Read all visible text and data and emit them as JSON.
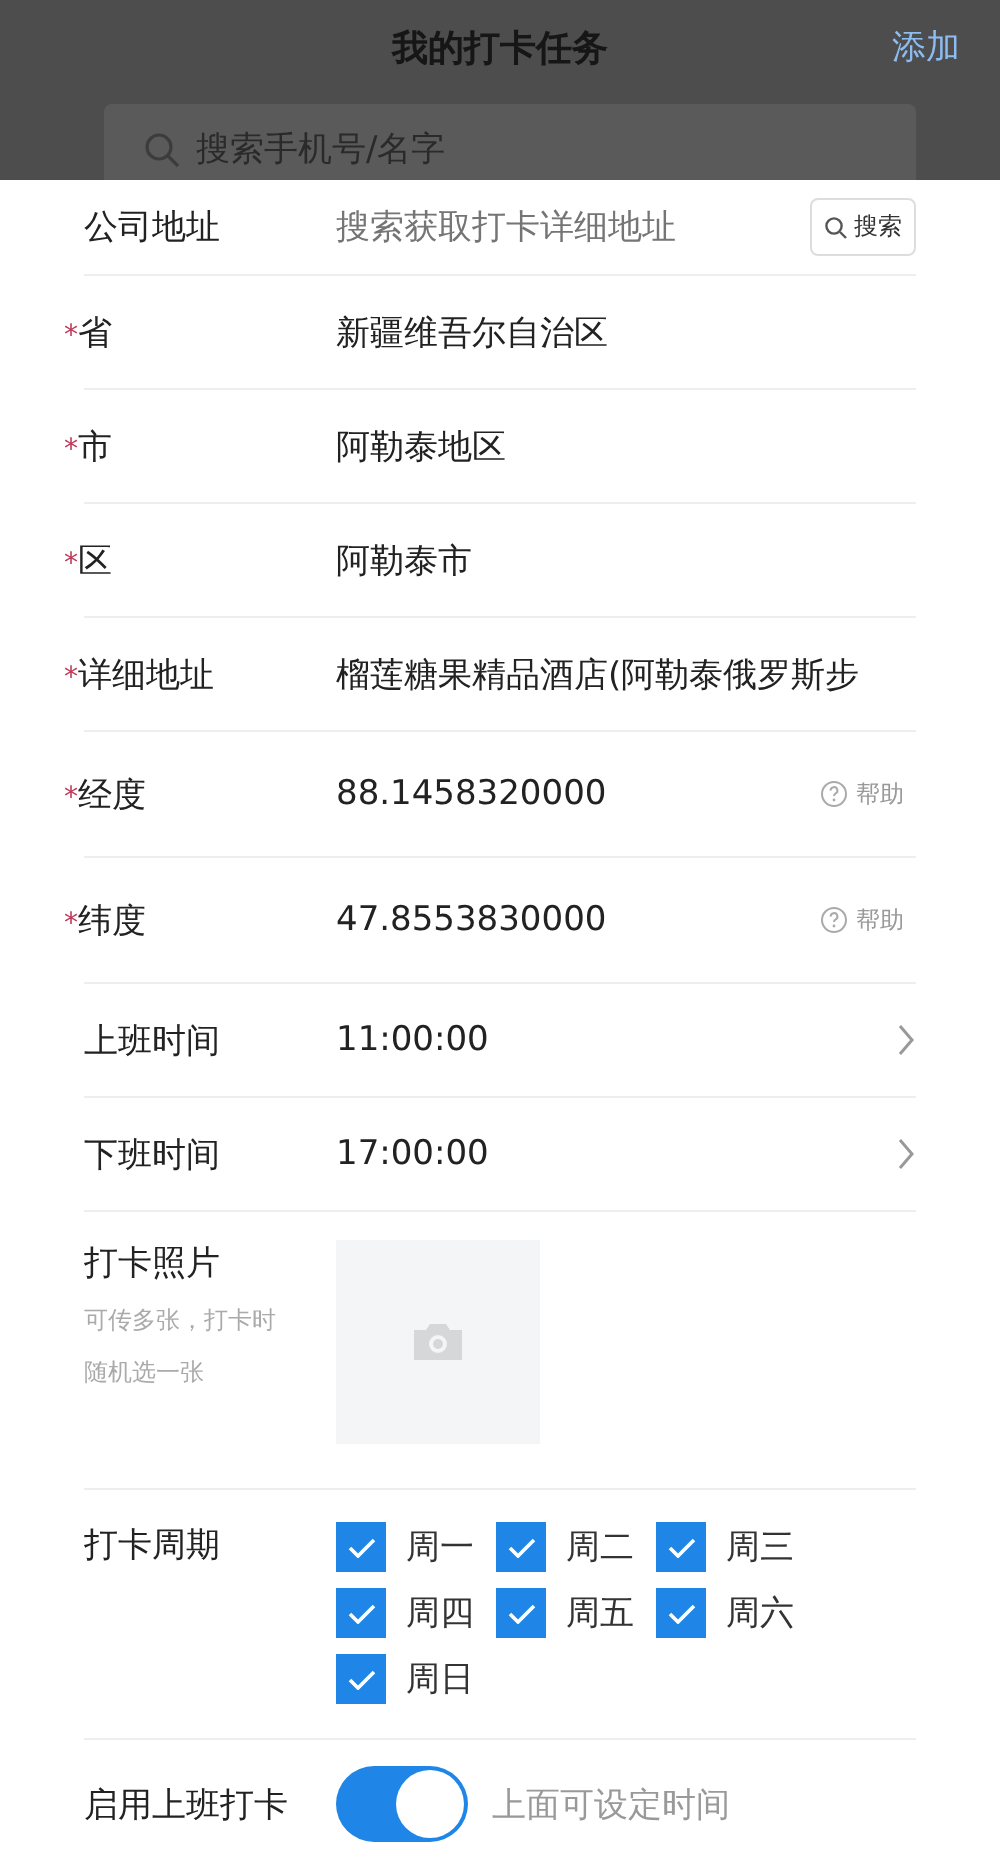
{
  "header": {
    "title": "我的打卡任务",
    "action": "添加",
    "search": {
      "placeholder": "搜索手机号/名字"
    }
  },
  "rows": [
    {
      "kind": "search",
      "label": "公司地址",
      "placeholder": "搜索获取打卡详细地址",
      "button": "搜索"
    },
    {
      "kind": "text",
      "label": "省",
      "mark": "*",
      "value": "新疆维吾尔自治区"
    },
    {
      "kind": "text",
      "label": "市",
      "mark": "*",
      "value": "阿勒泰地区"
    },
    {
      "kind": "text",
      "label": "区",
      "mark": "*",
      "value": "阿勒泰市"
    },
    {
      "kind": "text",
      "label": "详细地址",
      "mark": "*",
      "value": "榴莲糖果精品酒店(阿勒泰俄罗斯步"
    },
    {
      "kind": "coord",
      "label": "经度",
      "mark": "*",
      "value": "88.1458320000",
      "help": "帮助"
    },
    {
      "kind": "coord",
      "label": "纬度",
      "mark": "*",
      "value": "47.8553830000",
      "help": "帮助"
    },
    {
      "kind": "time",
      "label": "上班时间",
      "value": "11:00:00"
    },
    {
      "kind": "time",
      "label": "下班时间",
      "value": "17:00:00"
    },
    {
      "kind": "photo",
      "label": "打卡照片",
      "hint": [
        "可传多张，打卡时",
        "随机选一张"
      ]
    },
    {
      "kind": "days",
      "label": "打卡周期",
      "days": [
        {
          "label": "周一",
          "checked": true
        },
        {
          "label": "周二",
          "checked": true
        },
        {
          "label": "周三",
          "checked": true
        },
        {
          "label": "周四",
          "checked": true
        },
        {
          "label": "周五",
          "checked": true
        },
        {
          "label": "周六",
          "checked": true
        },
        {
          "label": "周日",
          "checked": true
        }
      ]
    },
    {
      "kind": "switch",
      "label": "启用上班打卡",
      "on": true,
      "note": "上面可设定时间"
    }
  ]
}
